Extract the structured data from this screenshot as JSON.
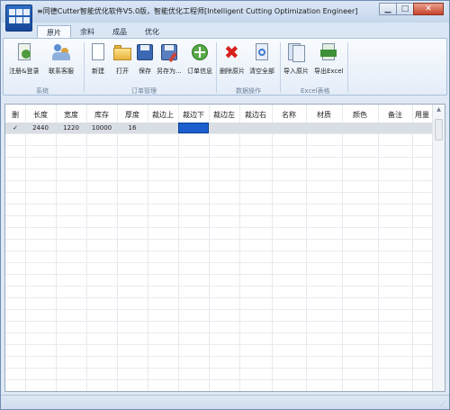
{
  "window": {
    "title": "≡同德Cutter智能优化软件V5.0版，智能优化工程师[Intelligent Cutting Optimization Engineer]",
    "minimize_icon": "minimize-icon",
    "maximize_icon": "maximize-icon",
    "close_icon": "close-icon"
  },
  "tabs": [
    "原片",
    "余料",
    "成品",
    "优化"
  ],
  "ribbon": {
    "groups": {
      "system": "系统",
      "order": "订单管理",
      "data": "数据操作",
      "excel": "Excel表格"
    },
    "buttons": {
      "register": "注册&登录",
      "contact": "联系客服",
      "new": "新建",
      "open": "打开",
      "save": "保存",
      "save_as": "另存为...",
      "order_info": "订单信息",
      "delete": "删除原片",
      "clear_all": "清空全部",
      "import": "导入原片",
      "export": "导出Excel"
    }
  },
  "grid": {
    "headers": [
      "删",
      "长度",
      "宽度",
      "库存",
      "厚度",
      "裁边上",
      "裁边下",
      "裁边左",
      "裁边右",
      "名称",
      "材质",
      "颜色",
      "备注",
      "用量"
    ],
    "rows": [
      [
        "✓",
        "2440",
        "1220",
        "10000",
        "16",
        "",
        "",
        "",
        "",
        "",
        "",
        "",
        "",
        ""
      ]
    ]
  },
  "colors": {
    "selected_cell": "#1b5fcf",
    "row_highlight": "#d9dee5",
    "ribbon_bg": "#f9fbfe"
  }
}
